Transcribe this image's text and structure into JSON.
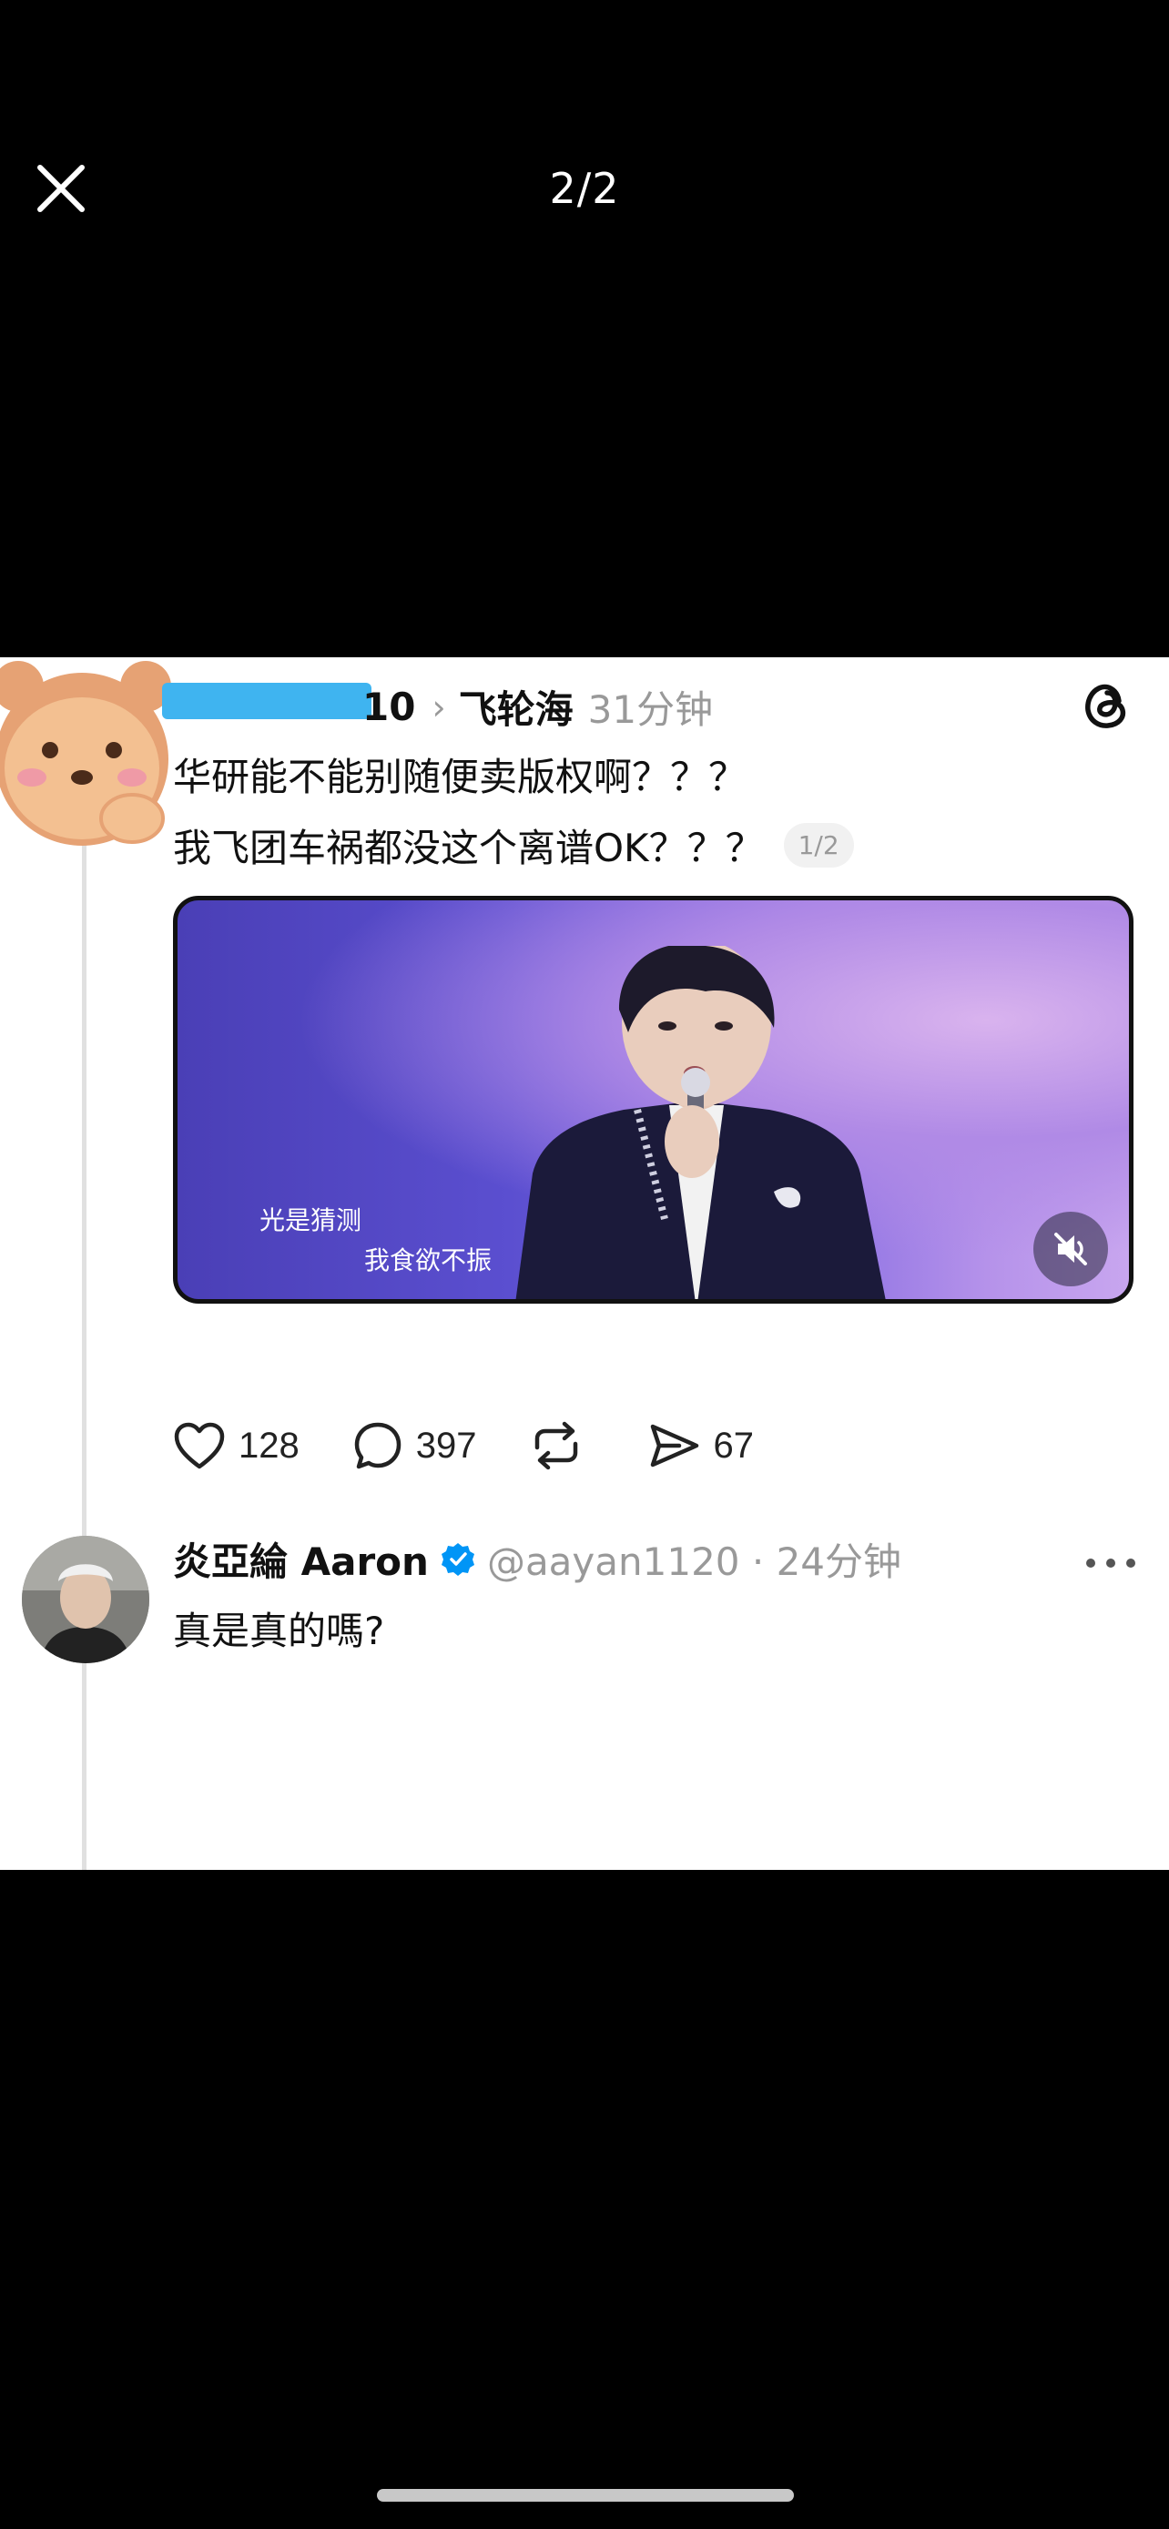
{
  "viewer": {
    "page_counter": "2/2",
    "close_icon": "close-icon"
  },
  "post": {
    "username_visible": "10",
    "topic": "飞轮海",
    "time": "31分钟",
    "text_line1": "华研能不能别随便卖版权啊？？？",
    "text_line2": "我飞团车祸都没这个离谱OK？？？",
    "page_indicator": "1/2",
    "video": {
      "subtitle_line1": "光是猜测",
      "subtitle_line2": "我食欲不振",
      "mute_icon": "muted-speaker-icon"
    },
    "actions": {
      "likes": "128",
      "comments": "397",
      "reposts": "",
      "shares": "67"
    }
  },
  "reply": {
    "name": "炎亞綸 Aaron",
    "verified": true,
    "handle": "@aayan1120 · 24分钟",
    "text": "真是真的嗎?"
  },
  "colors": {
    "background": "#000000",
    "card": "#ffffff",
    "verified": "#0095f6",
    "muted_text": "#999999"
  }
}
